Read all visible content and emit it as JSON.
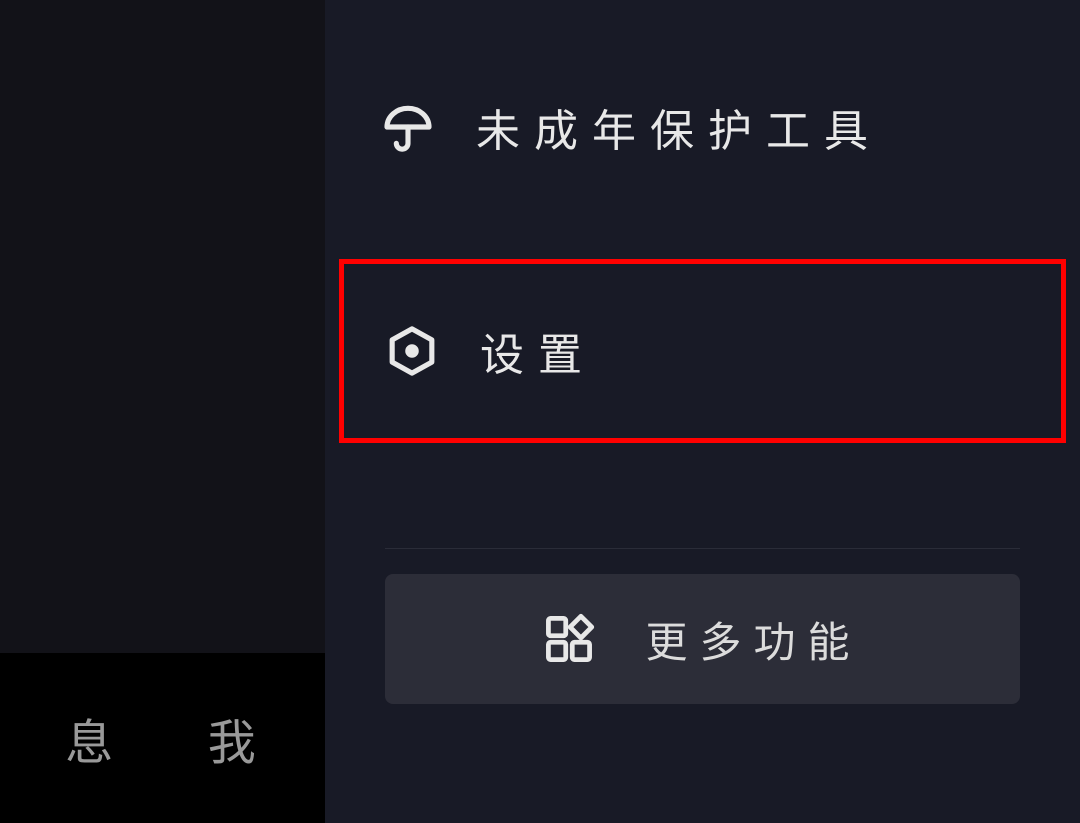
{
  "sidebar": {
    "nav": {
      "messages_label": "息",
      "me_label": "我"
    }
  },
  "menu": {
    "minor_protection": {
      "label": "未成年保护工具"
    },
    "settings": {
      "label": "设置"
    },
    "more": {
      "label": "更多功能"
    }
  }
}
